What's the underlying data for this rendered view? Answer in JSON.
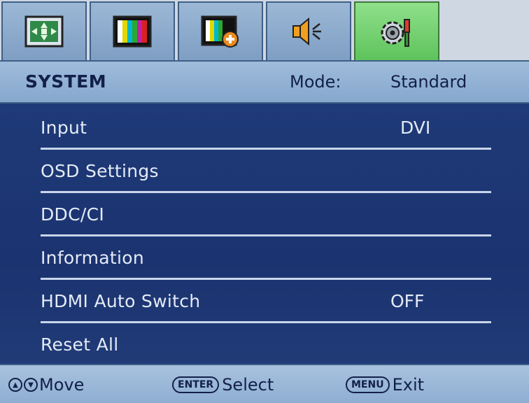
{
  "tabs": [
    {
      "icon": "picture-position-icon",
      "active": false
    },
    {
      "icon": "color-bars-icon",
      "active": false
    },
    {
      "icon": "picture-advanced-icon",
      "active": false
    },
    {
      "icon": "audio-speaker-icon",
      "active": false
    },
    {
      "icon": "system-settings-icon",
      "active": true
    }
  ],
  "header": {
    "title": "SYSTEM",
    "mode_label": "Mode:",
    "mode_value": "Standard"
  },
  "menu": {
    "items": [
      {
        "label": "Input",
        "value": "DVI"
      },
      {
        "label": "OSD Settings",
        "value": ""
      },
      {
        "label": "DDC/CI",
        "value": ""
      },
      {
        "label": "Information",
        "value": ""
      },
      {
        "label": "HDMI Auto Switch",
        "value": "OFF"
      },
      {
        "label": "Reset All",
        "value": ""
      }
    ]
  },
  "footer": {
    "move_label": "Move",
    "enter_key": "ENTER",
    "select_label": "Select",
    "menu_key": "MENU",
    "exit_label": "Exit"
  },
  "colors": {
    "active_tab": "#5cc25a",
    "menu_background": "#1b3370",
    "header_background": "#86a8cd",
    "text_dark": "#13204a",
    "text_light": "#e4ebf6"
  }
}
